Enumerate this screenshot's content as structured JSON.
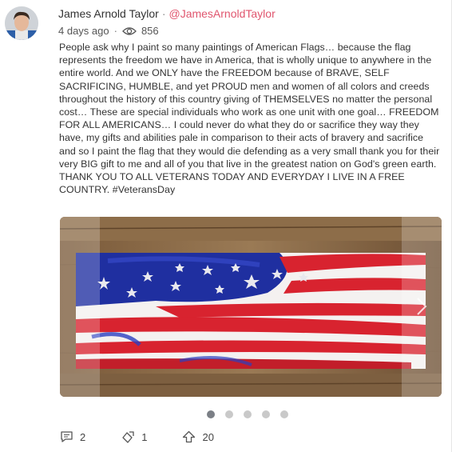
{
  "author": {
    "name": "James Arnold Taylor",
    "separator": "·",
    "handle": "@JamesArnoldTaylor"
  },
  "meta": {
    "time_ago": "4 days ago",
    "separator": "·",
    "views": "856"
  },
  "post_text": "People ask why I paint so many paintings of American Flags… because the flag represents the freedom we have in America, that is wholly unique to anywhere in the entire world. And we ONLY have the FREEDOM because of BRAVE, SELF SACRIFICING, HUMBLE, and yet PROUD men and women of all colors and creeds throughout the history of this country giving of THEMSELVES no matter the personal cost… These are special individuals who work as one unit with one goal… FREEDOM FOR ALL AMERICANS… I could never do what they do or sacrifice they way they have, my gifts and abilities pale in comparison to their acts of bravery and sacrifice and so I paint the flag that they would die defending as a very small thank you for their very BIG gift to me and all of you that live in the greatest nation on God's green earth. THANK YOU TO ALL VETERANS TODAY AND EVERYDAY I LIVE IN A FREE COUNTRY. #VeteransDay",
  "carousel": {
    "total": 5,
    "active_index": 0
  },
  "actions": {
    "comments": "2",
    "reposts": "1",
    "upvotes": "20"
  },
  "colors": {
    "handle": "#e0556e",
    "flag_blue": "#1f2fa0",
    "flag_red": "#d8232f",
    "wood": "#8a6a45"
  },
  "icons": [
    "eye-icon",
    "comment-icon",
    "repost-icon",
    "upvote-icon",
    "chevron-right-icon"
  ]
}
